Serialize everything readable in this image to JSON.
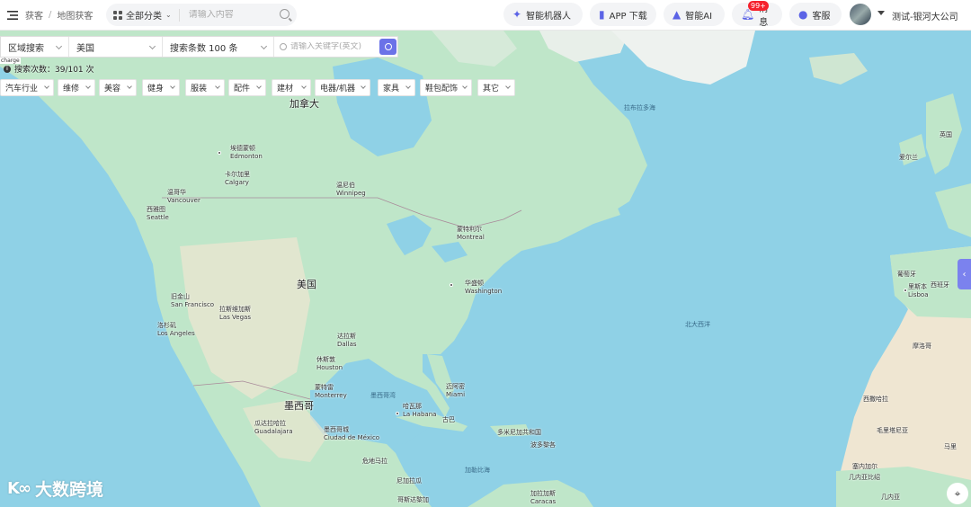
{
  "header": {
    "breadcrumb": [
      "获客",
      "地图获客"
    ],
    "category_select": "全部分类",
    "search_placeholder": "请输入内容",
    "actions": [
      {
        "label": "智能机器人",
        "icon": "sparkle-icon"
      },
      {
        "label": "APP 下载",
        "icon": "phone-icon"
      },
      {
        "label": "智能AI",
        "icon": "ai-logo-icon"
      },
      {
        "label": "消息",
        "icon": "bell-icon",
        "badge": "99+"
      },
      {
        "label": "客服",
        "icon": "chat-icon"
      }
    ],
    "user": "测试-银河大公司"
  },
  "search_bar": {
    "mode": "区域搜索",
    "region": "美国",
    "limit": "搜索条数 100 条",
    "keyword_placeholder": "请输入关键字(英文)"
  },
  "search_count": "搜索次数：39/101 次",
  "corner_tag": "charge",
  "filters": [
    "汽车行业",
    "维修",
    "美容",
    "健身",
    "服装",
    "配件",
    "建材",
    "电器/机器",
    "家具",
    "鞋包配饰",
    "其它"
  ],
  "map_labels": {
    "countries": [
      "加拿大",
      "美国",
      "墨西哥",
      "古巴",
      "英国",
      "爱尔兰",
      "葡萄牙",
      "西班牙",
      "摩洛哥",
      "西撒哈拉",
      "毛里塔尼亚",
      "马里",
      "塞内加尔",
      "几内亚比绍",
      "几内亚",
      "危地马拉",
      "尼加拉瓜",
      "哥斯达黎加",
      "多米尼加共和国",
      "波多黎各"
    ],
    "seas": [
      "拉布拉多海",
      "北大西洋",
      "墨西哥湾",
      "加勒比海"
    ],
    "cities": [
      [
        "埃德蒙顿",
        "Edmonton"
      ],
      [
        "卡尔加里",
        "Calgary"
      ],
      [
        "温哥华",
        "Vancouver"
      ],
      [
        "西雅图",
        "Seattle"
      ],
      [
        "温尼伯",
        "Winnipeg"
      ],
      [
        "蒙特利尔",
        "Montreal"
      ],
      [
        "华盛顿",
        "Washington"
      ],
      [
        "旧金山",
        "San Francisco"
      ],
      [
        "拉斯维加斯",
        "Las Vegas"
      ],
      [
        "洛杉矶",
        "Los Angeles"
      ],
      [
        "达拉斯",
        "Dallas"
      ],
      [
        "休斯敦",
        "Houston"
      ],
      [
        "蒙特雷",
        "Monterrey"
      ],
      [
        "迈阿密",
        "Miami"
      ],
      [
        "哈瓦那",
        "La Habana"
      ],
      [
        "瓜达拉哈拉",
        "Guadalajara"
      ],
      [
        "墨西哥城",
        "Ciudad de México"
      ],
      [
        "里斯本",
        "Lisboa"
      ],
      [
        "加拉加斯",
        "Caracas"
      ]
    ]
  },
  "watermark": "大数跨境",
  "colors": {
    "accent": "#6b72e8",
    "ocean": "#8fd1e6",
    "land": "#bfe6c9",
    "badge": "#f5222d"
  }
}
